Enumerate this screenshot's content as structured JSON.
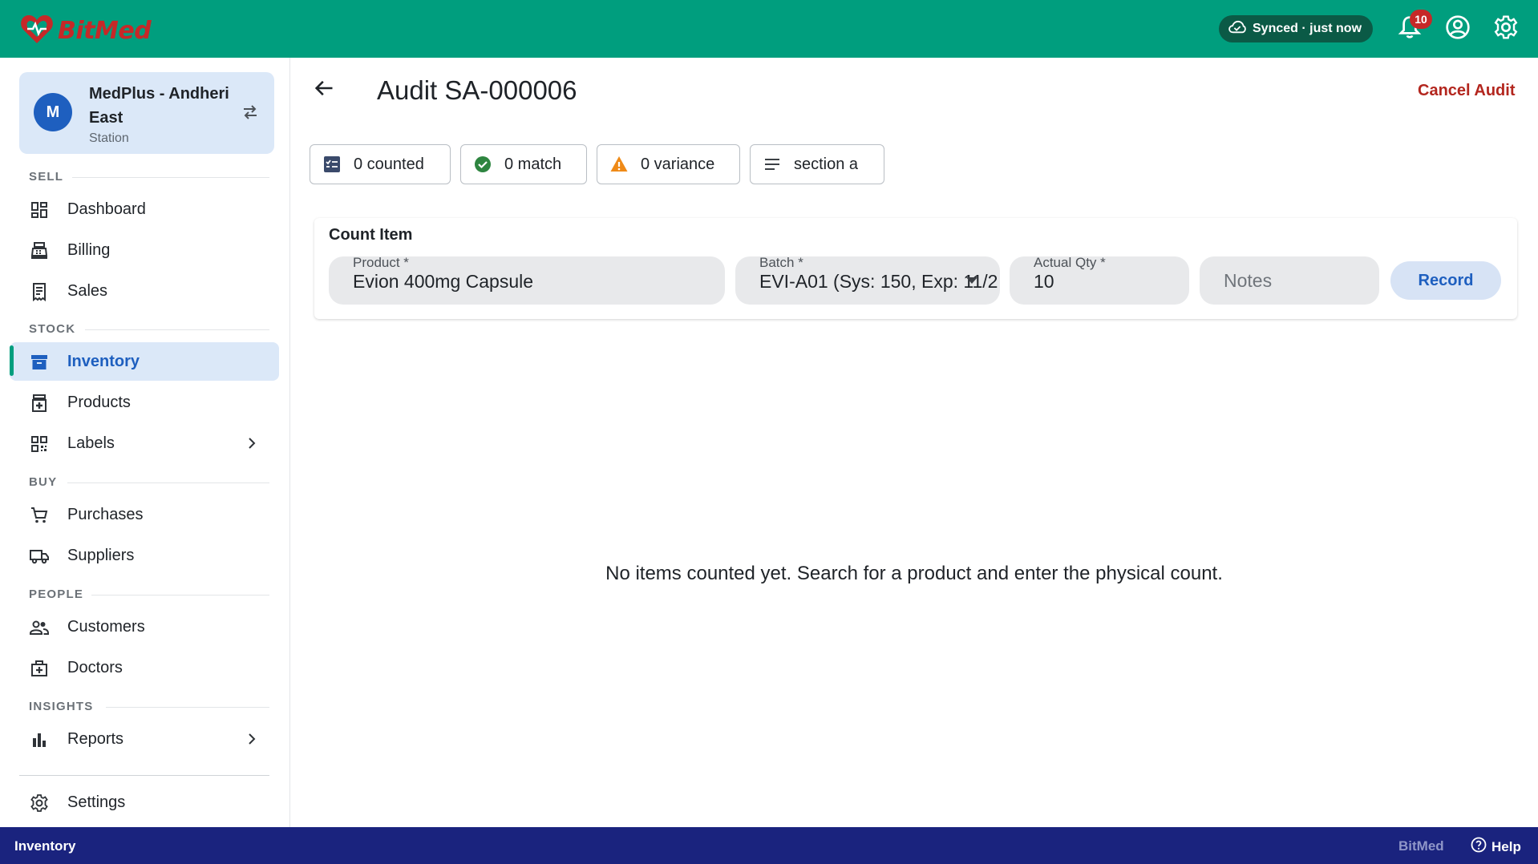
{
  "app": {
    "name": "BitMed",
    "brand_color": "#c62828",
    "header_color": "#009e7e"
  },
  "topbar": {
    "sync_status": "Synced · just now",
    "notifications_count": "10"
  },
  "org": {
    "avatar_letter": "M",
    "name": "MedPlus - Andheri East",
    "type": "Station"
  },
  "sidebar": {
    "sections": {
      "sell": "SELL",
      "stock": "STOCK",
      "buy": "BUY",
      "people": "PEOPLE",
      "insights": "INSIGHTS"
    },
    "items": {
      "dashboard": "Dashboard",
      "billing": "Billing",
      "sales": "Sales",
      "inventory": "Inventory",
      "products": "Products",
      "labels": "Labels",
      "purchases": "Purchases",
      "suppliers": "Suppliers",
      "customers": "Customers",
      "doctors": "Doctors",
      "reports": "Reports",
      "settings": "Settings"
    },
    "active": "Inventory"
  },
  "main": {
    "title": "Audit SA-000006",
    "cancel_label": "Cancel Audit",
    "chips": {
      "counted": "0 counted",
      "match": "0 match",
      "variance": "0 variance",
      "section": "section a"
    },
    "count_item": {
      "title": "Count Item",
      "product_label": "Product *",
      "product_value": "Evion 400mg Capsule",
      "batch_label": "Batch *",
      "batch_value": "EVI-A01 (Sys: 150, Exp: 11/2",
      "qty_label": "Actual Qty *",
      "qty_value": "10",
      "notes_placeholder": "Notes",
      "record_label": "Record"
    },
    "empty_message": "No items counted yet. Search for a product and enter the physical count."
  },
  "bottombar": {
    "current_page": "Inventory",
    "brand": "BitMed",
    "help_label": "Help"
  }
}
